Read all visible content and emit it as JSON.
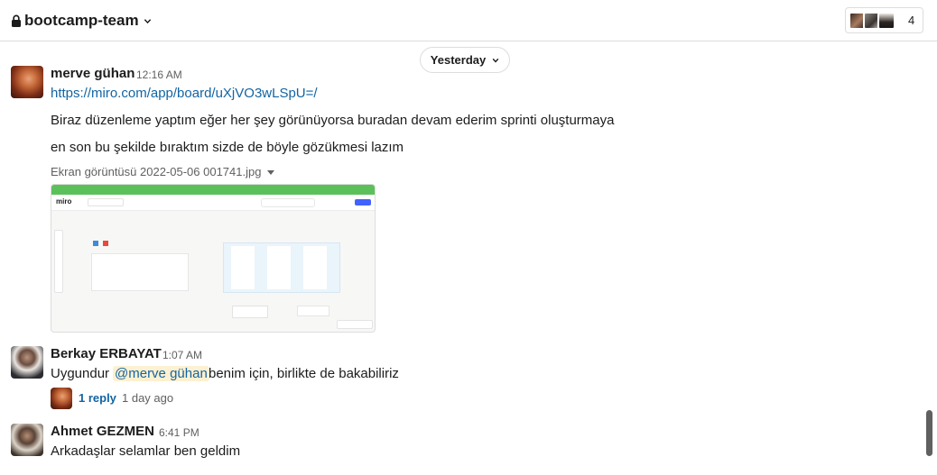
{
  "header": {
    "channel_name": "bootcamp-team",
    "member_count": "4"
  },
  "day_divider": {
    "label": "Yesterday"
  },
  "messages": [
    {
      "author": "merve gühan",
      "time": "12:16 AM",
      "link": "https://miro.com/app/board/uXjVO3wLSpU=/",
      "lines": [
        "Biraz düzenleme yaptım eğer her şey görünüyorsa buradan devam ederim sprinti oluşturmaya",
        "en son bu şekilde bıraktım sizde de böyle gözükmesi lazım"
      ],
      "file_name": "Ekran görüntüsü 2022-05-06 001741.jpg",
      "thumbnail": {
        "logo_text": "miro"
      }
    },
    {
      "author": "Berkay ERBAYAT",
      "time": "1:07 AM",
      "text_before": "Uygundur",
      "mention": "@merve gühan",
      "text_after": "benim için, birlikte de bakabiliriz",
      "replies": {
        "label": "1 reply",
        "time": "1 day ago"
      }
    },
    {
      "author": "Ahmet GEZMEN",
      "time": "6:41 PM",
      "text": "Arkadaşlar selamlar  ben geldim"
    }
  ],
  "colors": {
    "link": "#1264a3",
    "mention_bg": "#fdf1d2",
    "divider": "#dddddd",
    "muted_text": "#616061"
  }
}
